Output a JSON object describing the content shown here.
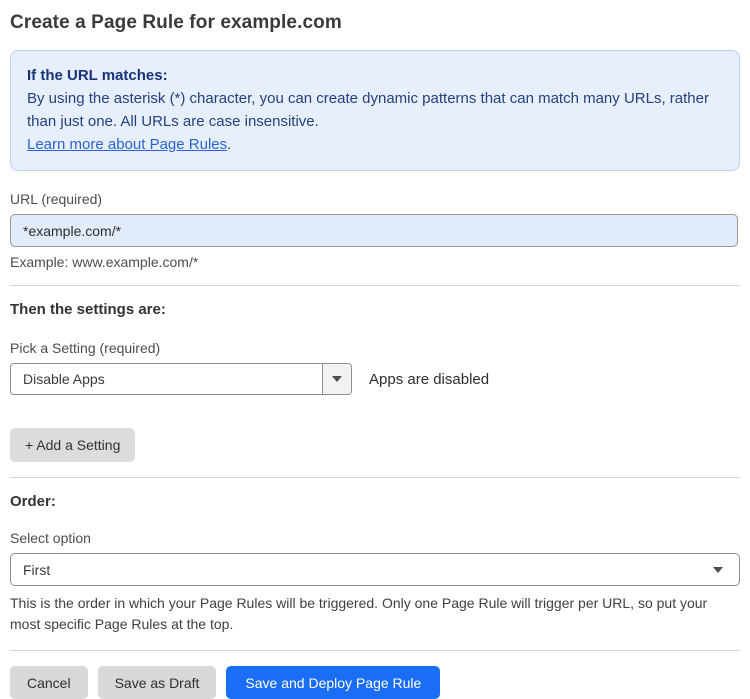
{
  "page": {
    "title": "Create a Page Rule for example.com"
  },
  "info_box": {
    "heading": "If the URL matches:",
    "body": "By using the asterisk (*) character, you can create dynamic patterns that can match many URLs, rather than just one. All URLs are case insensitive.",
    "link_label": "Learn more about Page Rules",
    "link_suffix": "."
  },
  "url_field": {
    "label": "URL (required)",
    "value": "*example.com/*",
    "example": "Example: www.example.com/*"
  },
  "settings": {
    "heading": "Then the settings are:",
    "picker_label": "Pick a Setting (required)",
    "selected_setting": "Disable Apps",
    "status_text": "Apps are disabled",
    "add_button_label": "+ Add a Setting"
  },
  "order": {
    "heading": "Order:",
    "select_label": "Select option",
    "selected_option": "First",
    "help_text": "This is the order in which your Page Rules will be triggered. Only one Page Rule will trigger per URL, so put your most specific Page Rules at the top."
  },
  "actions": {
    "cancel_label": "Cancel",
    "save_draft_label": "Save as Draft",
    "save_deploy_label": "Save and Deploy Page Rule"
  },
  "colors": {
    "accent_blue": "#1a6ef5",
    "info_box_background": "#e6effb",
    "info_box_border": "#b8d3f0",
    "info_text_navy": "#24427e",
    "link_blue": "#2b62d9",
    "url_input_background": "#e1ebf9",
    "gray_button_background": "#d8d8d8"
  }
}
